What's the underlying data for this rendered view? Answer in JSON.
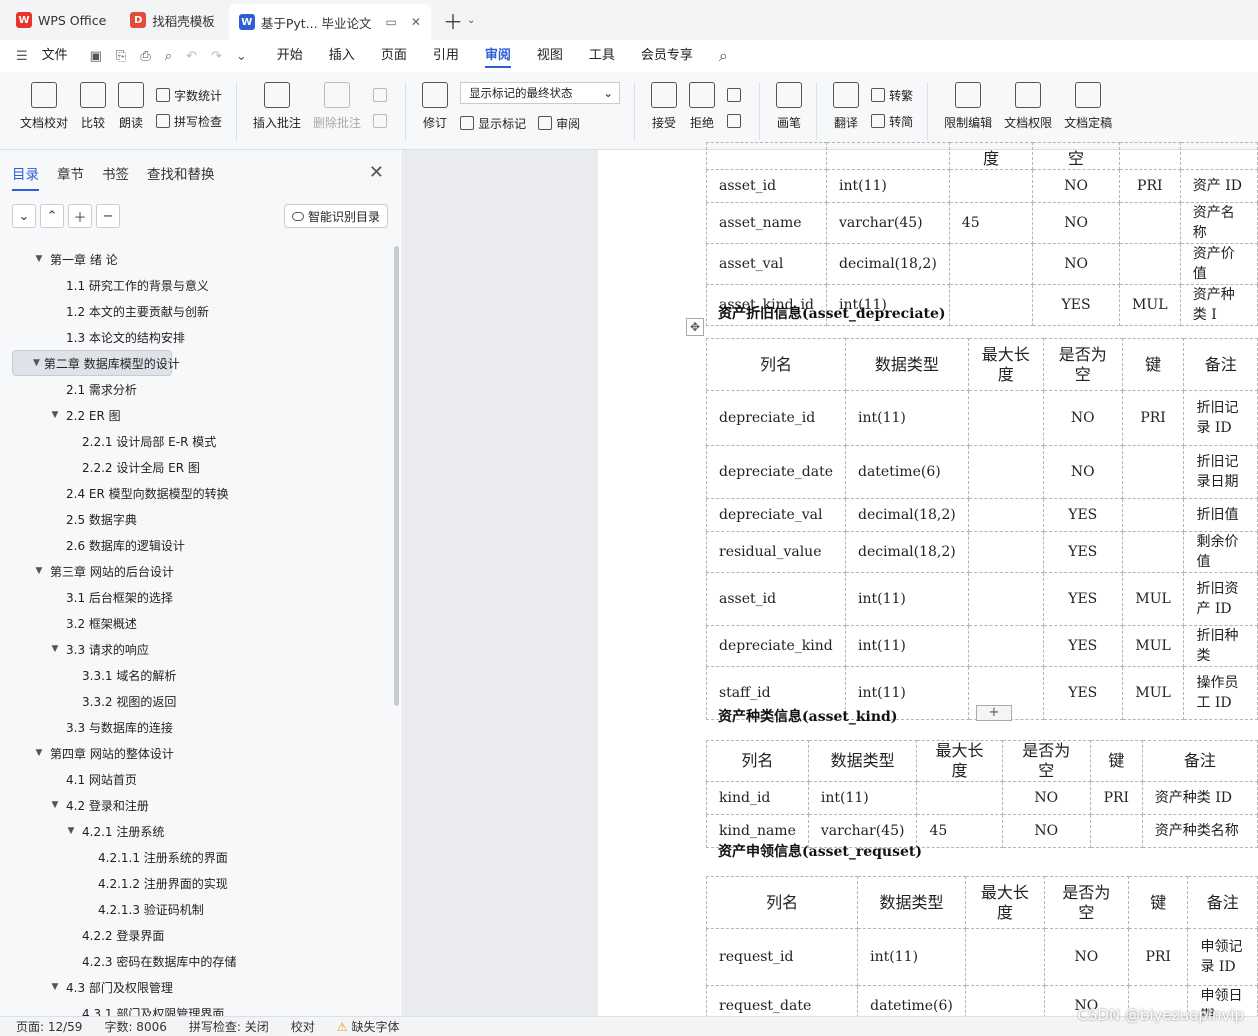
{
  "tabs": [
    {
      "label": "WPS Office",
      "logo": "W"
    },
    {
      "label": "找稻壳模板",
      "logo": "D"
    },
    {
      "label": "基于Pyt... 毕业论文",
      "logo": "W"
    }
  ],
  "menu": {
    "file": "文件",
    "items": [
      "开始",
      "插入",
      "页面",
      "引用",
      "审阅",
      "视图",
      "工具",
      "会员专享"
    ]
  },
  "ribbon": {
    "proofread": "文档校对",
    "compare": "比较",
    "read": "朗读",
    "wordcount": "字数统计",
    "spellcheck": "拼写检查",
    "insert_comment": "插入批注",
    "delete_comment": "删除批注",
    "revise": "修订",
    "markup_state": "显示标记的最终状态",
    "show_markup": "显示标记",
    "review": "审阅",
    "accept": "接受",
    "reject": "拒绝",
    "pen": "画笔",
    "translate": "翻译",
    "to_traditional": "转繁",
    "to_simplified": "转简",
    "restrict_edit": "限制编辑",
    "doc_permission": "文档权限",
    "doc_finalize": "文档定稿"
  },
  "nav": {
    "tabs": [
      "目录",
      "章节",
      "书签",
      "查找和替换"
    ],
    "smart_toc": "智能识别目录",
    "toc": [
      {
        "text": "第一章  绪  论",
        "level": 0,
        "toggle": "▼"
      },
      {
        "text": "1.1  研究工作的背景与意义",
        "level": 1
      },
      {
        "text": "1.2  本文的主要贡献与创新",
        "level": 1
      },
      {
        "text": "1.3  本论文的结构安排",
        "level": 1
      },
      {
        "text": "第二章  数据库模型的设计",
        "level": 0,
        "toggle": "▼",
        "selected": true
      },
      {
        "text": "2.1  需求分析",
        "level": 1
      },
      {
        "text": "2.2 ER 图",
        "level": 1,
        "toggle": "▼"
      },
      {
        "text": "2.2.1  设计局部 E-R 模式",
        "level": 2
      },
      {
        "text": "2.2.2  设计全局 ER 图",
        "level": 2
      },
      {
        "text": "2.4 ER 模型向数据模型的转换",
        "level": 1
      },
      {
        "text": "2.5  数据字典",
        "level": 1
      },
      {
        "text": "2.6  数据库的逻辑设计",
        "level": 1
      },
      {
        "text": "第三章  网站的后台设计",
        "level": 0,
        "toggle": "▼"
      },
      {
        "text": "3.1  后台框架的选择",
        "level": 1
      },
      {
        "text": "3.2  框架概述",
        "level": 1
      },
      {
        "text": "3.3  请求的响应",
        "level": 1,
        "toggle": "▼"
      },
      {
        "text": "3.3.1  域名的解析",
        "level": 2
      },
      {
        "text": "3.3.2  视图的返回",
        "level": 2
      },
      {
        "text": "3.3  与数据库的连接",
        "level": 1
      },
      {
        "text": "第四章  网站的整体设计",
        "level": 0,
        "toggle": "▼"
      },
      {
        "text": "4.1  网站首页",
        "level": 1
      },
      {
        "text": "4.2  登录和注册",
        "level": 1,
        "toggle": "▼"
      },
      {
        "text": "4.2.1  注册系统",
        "level": 2,
        "toggle": "▼"
      },
      {
        "text": "4.2.1.1 注册系统的界面",
        "level": 3
      },
      {
        "text": "4.2.1.2  注册界面的实现",
        "level": 3
      },
      {
        "text": "4.2.1.3  验证码机制",
        "level": 3
      },
      {
        "text": "4.2.2  登录界面",
        "level": 2
      },
      {
        "text": "4.2.3  密码在数据库中的存储",
        "level": 2
      },
      {
        "text": "4.3  部门及权限管理",
        "level": 1,
        "toggle": "▼"
      },
      {
        "text": "4.3.1  部门及权限管理界面",
        "level": 2
      }
    ]
  },
  "doc": {
    "table1": {
      "header_partial": [
        "",
        "",
        "度",
        "空",
        "",
        ""
      ],
      "rows": [
        [
          "asset_id",
          "int(11)",
          "",
          "NO",
          "PRI",
          "资产 ID"
        ],
        [
          "asset_name",
          "varchar(45)",
          "45",
          "NO",
          "",
          "资产名称"
        ],
        [
          "asset_val",
          "decimal(18,2)",
          "",
          "NO",
          "",
          "资产价值"
        ],
        [
          "asset_kind_id",
          "int(11)",
          "",
          "YES",
          "MUL",
          "资产种类 I"
        ]
      ]
    },
    "caption2": "资产折旧信息(asset_depreciate)",
    "table2": {
      "header": [
        "列名",
        "数据类型",
        "最大长度",
        "是否为空",
        "键",
        "备注"
      ],
      "rows": [
        [
          "depreciate_id",
          "int(11)",
          "",
          "NO",
          "PRI",
          "折旧记录 ID"
        ],
        [
          "depreciate_date",
          "datetime(6)",
          "",
          "NO",
          "",
          "折旧记录日期"
        ],
        [
          "depreciate_val",
          "decimal(18,2)",
          "",
          "YES",
          "",
          "折旧值"
        ],
        [
          "residual_value",
          "decimal(18,2)",
          "",
          "YES",
          "",
          "剩余价值"
        ],
        [
          "asset_id",
          "int(11)",
          "",
          "YES",
          "MUL",
          "折旧资产 ID"
        ],
        [
          "depreciate_kind",
          "int(11)",
          "",
          "YES",
          "MUL",
          "折旧种类"
        ],
        [
          "staff_id",
          "int(11)",
          "",
          "YES",
          "MUL",
          "操作员工 ID"
        ]
      ]
    },
    "caption3": "资产种类信息(asset_kind)",
    "table3": {
      "header": [
        "列名",
        "数据类型",
        "最大长度",
        "是否为空",
        "键",
        "备注"
      ],
      "rows": [
        [
          "kind_id",
          "int(11)",
          "",
          "NO",
          "PRI",
          "资产种类 ID"
        ],
        [
          "kind_name",
          "varchar(45)",
          "45",
          "NO",
          "",
          "资产种类名称"
        ]
      ]
    },
    "caption4": "资产申领信息(asset_requset)",
    "table4": {
      "header": [
        "列名",
        "数据类型",
        "最大长度",
        "是否为空",
        "键",
        "备注"
      ],
      "rows": [
        [
          "request_id",
          "int(11)",
          "",
          "NO",
          "PRI",
          "申领记录 ID"
        ],
        [
          "request_date",
          "datetime(6)",
          "",
          "NO",
          "",
          "申领日期"
        ]
      ]
    }
  },
  "status": {
    "page": "页面: 12/59",
    "words": "字数: 8006",
    "spell": "拼写检查: 关闭",
    "proof": "校对",
    "missing_font": "缺失字体"
  },
  "watermark": "CSDN @biyezuopinvip"
}
